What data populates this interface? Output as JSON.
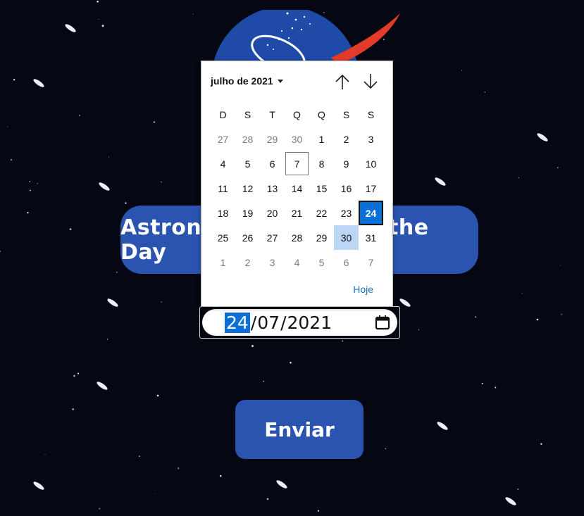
{
  "colors": {
    "background": "#050812",
    "accent_blue": "#2a54b0",
    "selected_blue": "#0a6fd6",
    "hover_blue": "#bcd6f5",
    "link_blue": "#1a6fc4",
    "nasa_red": "#e43a2a",
    "nasa_blue": "#1f4aa8"
  },
  "title": {
    "text": "Astronomy Picture of the Day"
  },
  "date_input": {
    "day": "24",
    "month": "07",
    "year": "2021",
    "sep": "/",
    "icon": "calendar-icon"
  },
  "calendar": {
    "month_label": "julho de 2021",
    "nav_up_icon": "arrow-up-icon",
    "nav_down_icon": "arrow-down-icon",
    "weekdays": [
      "D",
      "S",
      "T",
      "Q",
      "Q",
      "S",
      "S"
    ],
    "weeks": [
      [
        {
          "d": "27",
          "o": true
        },
        {
          "d": "28",
          "o": true
        },
        {
          "d": "29",
          "o": true
        },
        {
          "d": "30",
          "o": true
        },
        {
          "d": "1"
        },
        {
          "d": "2"
        },
        {
          "d": "3"
        }
      ],
      [
        {
          "d": "4"
        },
        {
          "d": "5"
        },
        {
          "d": "6"
        },
        {
          "d": "7",
          "today": true
        },
        {
          "d": "8"
        },
        {
          "d": "9"
        },
        {
          "d": "10"
        }
      ],
      [
        {
          "d": "11"
        },
        {
          "d": "12"
        },
        {
          "d": "13"
        },
        {
          "d": "14"
        },
        {
          "d": "15"
        },
        {
          "d": "16"
        },
        {
          "d": "17"
        }
      ],
      [
        {
          "d": "18"
        },
        {
          "d": "19"
        },
        {
          "d": "20"
        },
        {
          "d": "21"
        },
        {
          "d": "22"
        },
        {
          "d": "23"
        },
        {
          "d": "24",
          "selected": true
        }
      ],
      [
        {
          "d": "25"
        },
        {
          "d": "26"
        },
        {
          "d": "27"
        },
        {
          "d": "28"
        },
        {
          "d": "29"
        },
        {
          "d": "30",
          "hover": true
        },
        {
          "d": "31"
        }
      ],
      [
        {
          "d": "1",
          "o": true
        },
        {
          "d": "2",
          "o": true
        },
        {
          "d": "3",
          "o": true
        },
        {
          "d": "4",
          "o": true
        },
        {
          "d": "5",
          "o": true
        },
        {
          "d": "6",
          "o": true
        },
        {
          "d": "7",
          "o": true
        }
      ]
    ],
    "today_label": "Hoje"
  },
  "submit": {
    "label": "Enviar"
  }
}
